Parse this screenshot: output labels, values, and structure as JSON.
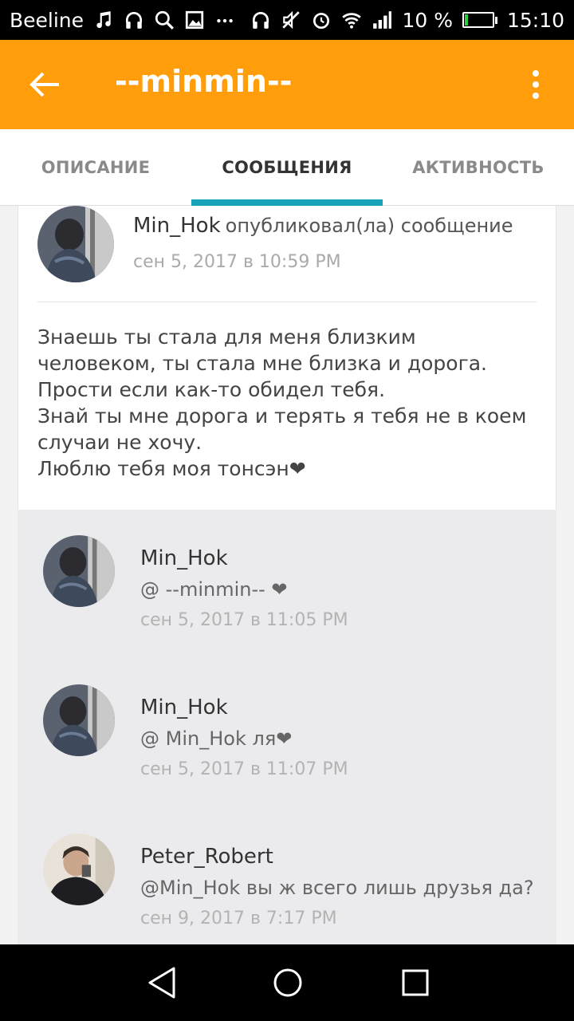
{
  "status_bar": {
    "carrier": "Beeline",
    "battery": "10 %",
    "battery_level": 0.1,
    "time": "15:10"
  },
  "app_bar": {
    "title": "--minmin--",
    "back_icon": "arrow-left-icon",
    "menu_icon": "more-vert-icon",
    "color": "#ff9d0a"
  },
  "tabs": [
    {
      "label": "ОПИСАНИЕ"
    },
    {
      "label": "СООБЩЕНИЯ",
      "active": true
    },
    {
      "label": "АКТИВНОСТЬ"
    }
  ],
  "accent": "#19a3b8",
  "post": {
    "author": "Min_Hok",
    "action": "опубликовал(ла) сообщение",
    "time": "сен 5, 2017 в 10:59 PM",
    "lines": [
      "Знаешь ты стала для меня близким",
      "человеком, ты стала мне близка и дорога.",
      "Прости если как-то обидел тебя.",
      "Знай ты мне дорога и терять я тебя не в коем",
      "случаи не хочу.",
      "Люблю тебя моя тонсэн❤"
    ]
  },
  "comments": [
    {
      "author": "Min_Hok",
      "text": "@ --minmin--  ❤",
      "time": "сен 5, 2017 в 11:05 PM"
    },
    {
      "author": "Min_Hok",
      "text": "@ Min_Hok  ля❤",
      "time": "сен 5, 2017 в 11:07 PM"
    },
    {
      "author": "Peter_Robert",
      "text": "@Min_Hok  вы ж всего лишь друзья да?",
      "time": "сен 9, 2017 в 7:17 PM"
    }
  ],
  "nav": {
    "back_icon": "triangle-back-icon",
    "home_icon": "circle-home-icon",
    "recents_icon": "square-recents-icon"
  }
}
